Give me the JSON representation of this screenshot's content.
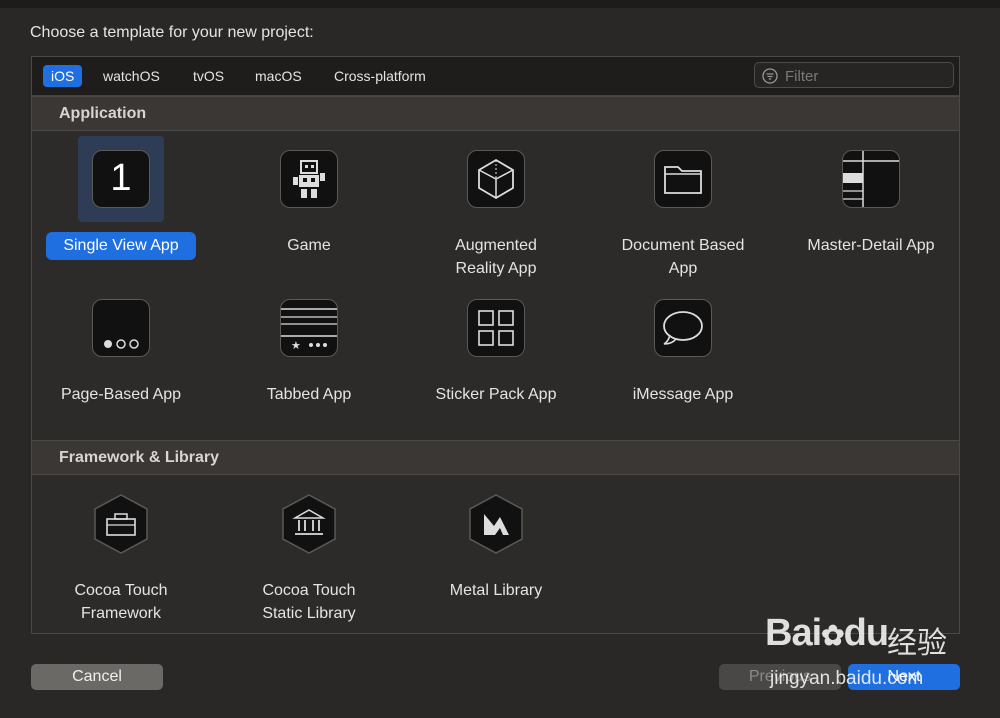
{
  "dialog": {
    "prompt": "Choose a template for your new project:"
  },
  "platform_tabs": [
    {
      "label": "iOS",
      "active": true
    },
    {
      "label": "watchOS",
      "active": false
    },
    {
      "label": "tvOS",
      "active": false
    },
    {
      "label": "macOS",
      "active": false
    },
    {
      "label": "Cross-platform",
      "active": false
    }
  ],
  "filter": {
    "placeholder": "Filter",
    "value": ""
  },
  "sections": {
    "application": {
      "title": "Application",
      "templates": [
        {
          "label": "Single View App",
          "icon": "single-view-app-icon",
          "selected": true
        },
        {
          "label": "Game",
          "icon": "game-icon"
        },
        {
          "label": "Augmented\nReality App",
          "icon": "augmented-reality-icon"
        },
        {
          "label": "Document Based\nApp",
          "icon": "document-folder-icon"
        },
        {
          "label": "Master-Detail App",
          "icon": "master-detail-icon"
        },
        {
          "label": "Page-Based App",
          "icon": "page-based-icon"
        },
        {
          "label": "Tabbed App",
          "icon": "tabbed-app-icon"
        },
        {
          "label": "Sticker Pack App",
          "icon": "sticker-pack-icon"
        },
        {
          "label": "iMessage App",
          "icon": "imessage-bubble-icon"
        }
      ]
    },
    "framework": {
      "title": "Framework & Library",
      "templates": [
        {
          "label": "Cocoa Touch\nFramework",
          "icon": "toolbox-icon"
        },
        {
          "label": "Cocoa Touch\nStatic Library",
          "icon": "library-building-icon"
        },
        {
          "label": "Metal Library",
          "icon": "metal-icon"
        }
      ]
    }
  },
  "icon_glyphs": {
    "single_view_number": "1"
  },
  "buttons": {
    "cancel": "Cancel",
    "previous": "Previous",
    "next": "Next"
  },
  "watermark": {
    "logo": "Bai",
    "logo_tail": "du",
    "chinese": "经验",
    "url": "jingyan.baidu.com"
  },
  "colors": {
    "accent": "#1f6fe0",
    "background": "#2a2826",
    "panel": "#2d2b29",
    "section_header": "#3a3734"
  }
}
